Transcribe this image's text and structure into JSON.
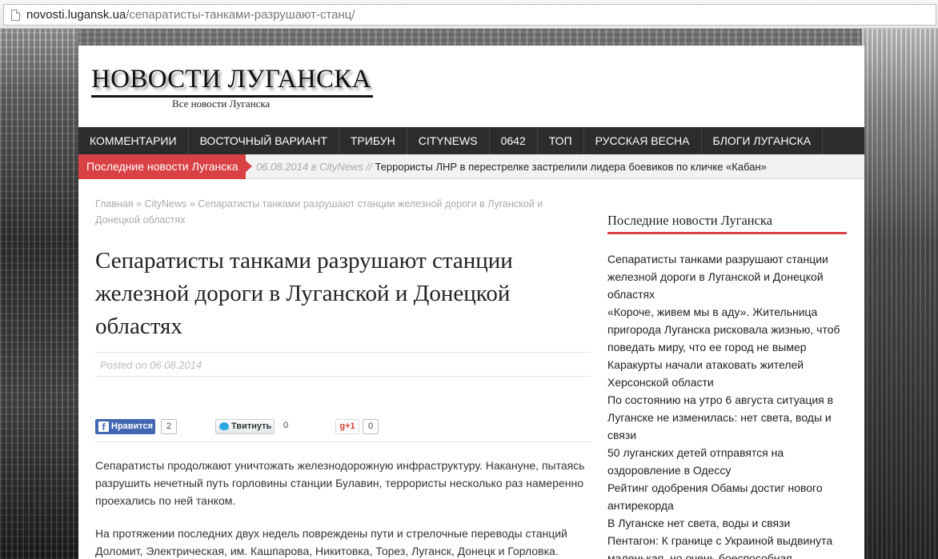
{
  "browser": {
    "url_host": "novosti.lugansk.ua",
    "url_path": "/сепаратисты-танками-разрушают-станц/"
  },
  "site": {
    "logo": "НОВОСТИ ЛУГАНСКА",
    "tagline": "Все новости Луганска"
  },
  "nav": {
    "items": [
      {
        "label": "КОММЕНТАРИИ"
      },
      {
        "label": "ВОСТОЧНЫЙ ВАРИАНТ"
      },
      {
        "label": "ТРИБУН"
      },
      {
        "label": "CITYNEWS"
      },
      {
        "label": "0642"
      },
      {
        "label": "ТОП"
      },
      {
        "label": "РУССКАЯ ВЕСНА"
      },
      {
        "label": "БЛОГИ ЛУГАНСКА"
      }
    ]
  },
  "ticker": {
    "label": "Последние новости Луганска",
    "date": "06.08.2014 в CityNews //",
    "text": "Террористы ЛНР в перестрелке застрелили лидера боевиков по кличке «Кабан»"
  },
  "breadcrumb": {
    "home": "Главная",
    "sep1": " » ",
    "category": "CityNews",
    "sep2": " » ",
    "current": "Сепаратисты танками разрушают станции железной дороги в Луганской и Донецкой областях"
  },
  "article": {
    "title": "Сепаратисты танками разрушают станции железной дороги в Луганской и Донецкой областях",
    "posted": "Posted on 06.08.2014",
    "paragraphs": [
      "Сепаратисты продолжают уничтожать железнодорожную инфраструктуру. Накануне, пытаясь разрушить нечетный путь горловины станции Булавин, террористы несколько раз намеренно проехались по ней танком.",
      "На протяжении последних двух недель повреждены пути и стрелочные переводы станций Доломит, Электрическая, им. Кашпарова, Никитовка, Торез, Луганск, Донецк и Горловка."
    ]
  },
  "social": {
    "fb_label": "Нравится",
    "fb_icon": "f",
    "fb_count": "2",
    "tw_label": "Твитнуть",
    "tw_count": "0",
    "gp_label": "g+1",
    "gp_count": "0"
  },
  "sidebar": {
    "title": "Последние новости Луганска",
    "items": [
      {
        "text": "Сепаратисты танками разрушают станции железной дороги в Луганской и Донецкой областях"
      },
      {
        "text": "«Короче, живем мы в аду». Жительница пригорода Луганска рисковала жизнью, чтоб поведать миру, что ее город не вымер"
      },
      {
        "text": "Каракурты начали атаковать жителей Херсонской области"
      },
      {
        "text": "По состоянию на утро 6 августа ситуация в Луганске не изменилась: нет света, воды и связи"
      },
      {
        "text": "50 луганских детей отправятся на оздоровление в Одессу"
      },
      {
        "text": "Рейтинг одобрения Обамы достиг нового антирекорда"
      },
      {
        "text": "В Луганске нет света, воды и связи"
      },
      {
        "text": "Пентагон: К границе с Украиной выдвинута маленькая, но очень боеспособная"
      }
    ]
  }
}
